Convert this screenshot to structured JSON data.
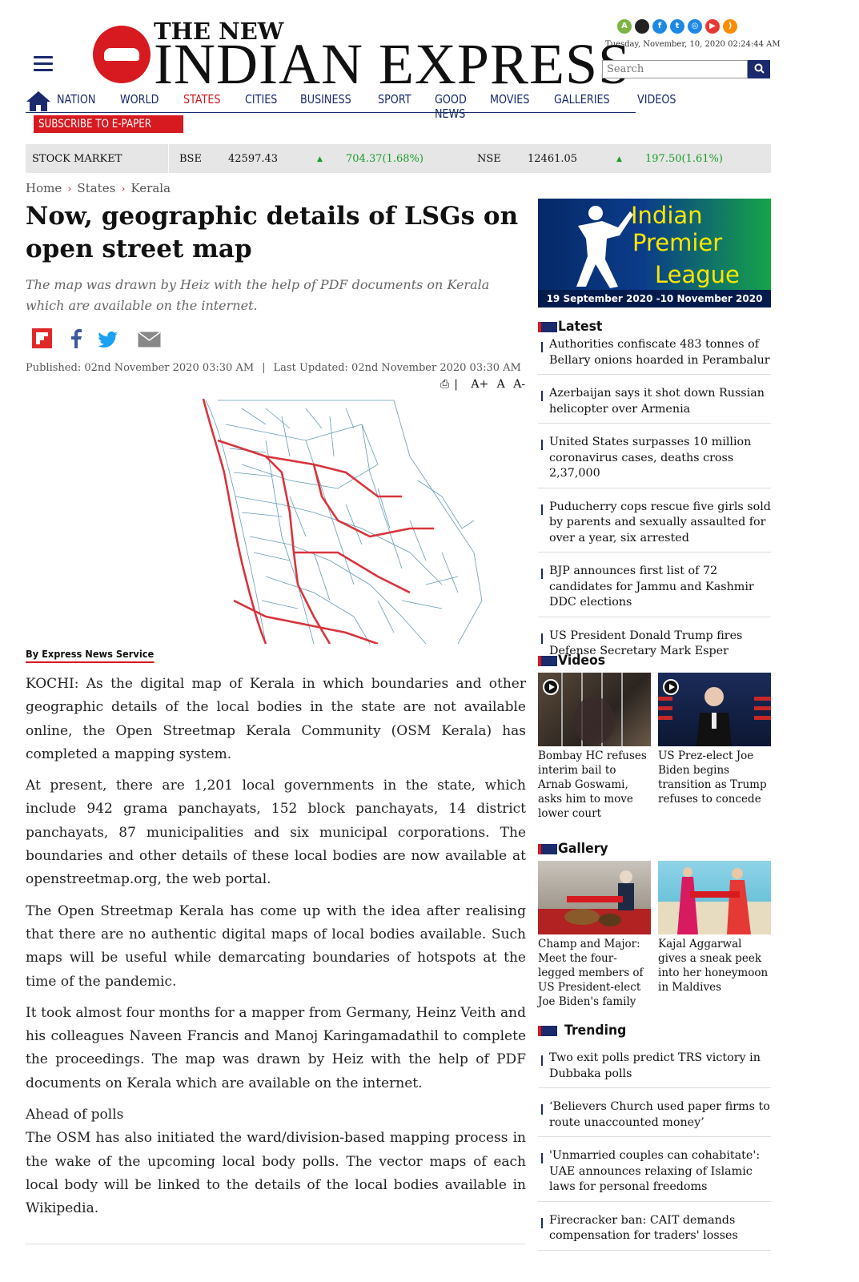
{
  "header": {
    "logo_top": "THE NEW",
    "logo_main": "INDIAN EXPRESS",
    "date": "Tuesday, November, 10, 2020  02:24:44 AM",
    "search_placeholder": "Search",
    "social_icons": [
      "android-icon",
      "apple-icon",
      "facebook-icon",
      "twitter-icon",
      "instagram-icon",
      "youtube-icon",
      "rss-icon"
    ]
  },
  "nav": {
    "items": [
      "NATION",
      "WORLD",
      "STATES",
      "CITIES",
      "BUSINESS",
      "SPORT",
      "GOOD NEWS",
      "MOVIES",
      "GALLERIES",
      "VIDEOS"
    ],
    "active": "STATES",
    "epaper": "SUBSCRIBE TO E-PAPER"
  },
  "stock": {
    "label": "STOCK MARKET",
    "bse_label": "BSE",
    "bse_value": "42597.43",
    "bse_change": "704.37(1.68%)",
    "nse_label": "NSE",
    "nse_value": "12461.05",
    "nse_change": "197.50(1.61%)"
  },
  "breadcrumb": [
    "Home",
    "States",
    "Kerala"
  ],
  "article": {
    "title": "Now, geographic details of LSGs on open street map",
    "summary": "The map was drawn by Heiz with the help of PDF documents on Kerala which are available on the internet.",
    "published": "Published: 02nd November 2020 03:30 AM",
    "updated": "Last Updated: 02nd November 2020 03:30 AM",
    "font_tools": [
      "A+",
      "A",
      "A-"
    ],
    "byline": "By Express News Service",
    "paragraphs": [
      "KOCHI: As the digital map of Kerala in which boundaries and other geographic details of the local bodies in the state are not available online, the Open Streetmap Kerala Community (OSM Kerala) has completed a mapping system.",
      "At present, there are 1,201 local governments in the state, which include 942 grama panchayats, 152 block panchayats, 14 district panchayats, 87 municipalities and six municipal corporations. The boundaries and other details of these local bodies are now available at openstreetmap.org, the web portal.",
      "The Open Streetmap Kerala has come up with the idea after realising that there are no authentic digital maps of local bodies available. Such maps will be useful while demarcating boundaries of hotspots at the time of the pandemic.",
      "It took almost four months for a mapper from Germany, Heinz Veith and his colleagues Naveen Francis and Manoj Karingamadathil to complete the proceedings. The map was drawn by Heiz with the help of PDF documents on Kerala which are available on the internet."
    ],
    "subhead": "Ahead of polls",
    "last_paragraph": "The OSM has also initiated the ward/division-based mapping process in the wake of the upcoming local body polls. The vector maps of each local body will be linked to the details of the local bodies available in Wikipedia."
  },
  "sidebar": {
    "ipl": {
      "line1": "Indian",
      "line2": "Premier",
      "line3": "League",
      "dates": "19 September 2020 -10 November 2020"
    },
    "latest_title": "Latest",
    "latest": [
      "Authorities confiscate 483 tonnes of Bellary onions hoarded in Perambalur",
      "Azerbaijan says it shot down Russian helicopter over Armenia",
      "United States surpasses 10 million coronavirus cases, deaths cross 2,37,000",
      "Puducherry cops rescue five girls sold by parents and sexually assaulted for over a year, six arrested",
      "BJP announces first list of 72 candidates for Jammu and Kashmir DDC elections",
      "US President Donald Trump fires Defense Secretary Mark Esper"
    ],
    "videos_title": "Videos",
    "videos": [
      "Bombay HC refuses interim bail to Arnab Goswami, asks him to move lower court",
      "US Prez-elect Joe Biden begins transition as Trump refuses to concede"
    ],
    "gallery_title": "Gallery",
    "gallery": [
      "Champ and Major: Meet the four-legged members of US President-elect Joe Biden's family",
      "Kajal Aggarwal gives a sneak peek into her honeymoon in Maldives"
    ],
    "trending_title": "Trending",
    "trending": [
      "Two exit polls predict TRS victory in Dubbaka polls",
      "‘Believers Church used paper firms to route unaccounted money’",
      "'Unmarried couples can cohabitate': UAE announces relaxing of Islamic laws for personal freedoms",
      "Firecracker ban: CAIT demands compensation for traders' losses"
    ]
  }
}
